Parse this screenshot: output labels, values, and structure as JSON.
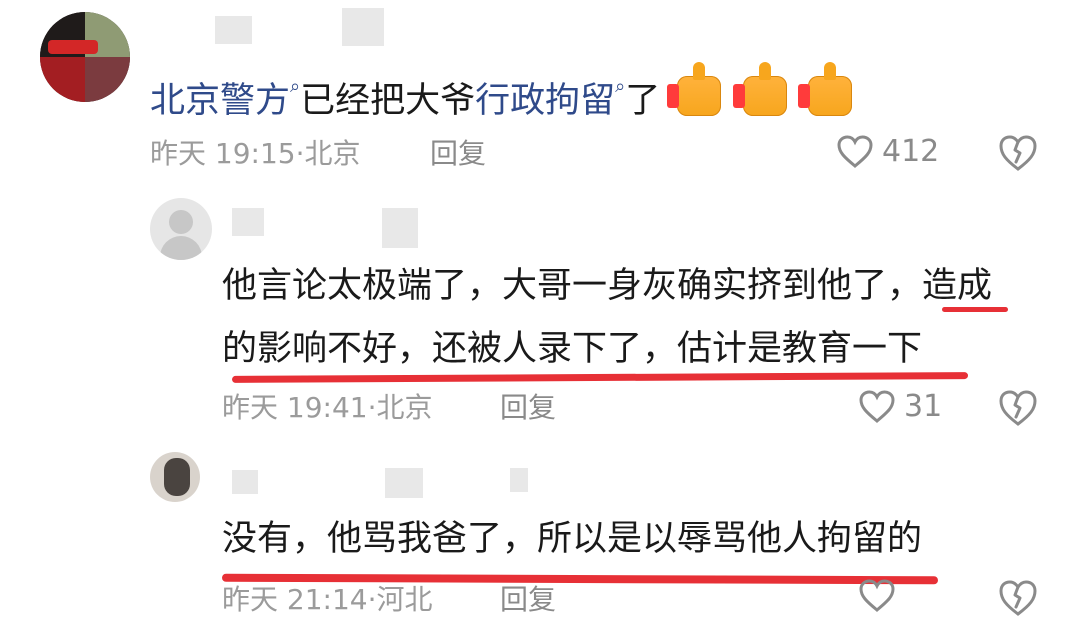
{
  "comments": [
    {
      "text_parts": {
        "topic_1": "北京警方",
        "text_1": "已经把大爷",
        "topic_2": "行政拘留",
        "text_2": "了"
      },
      "time": "昨天 19:15·北京",
      "reply_label": "回复",
      "likes": "412"
    },
    {
      "lines": [
        "他言论太极端了，大哥一身灰确实挤到他了，造成",
        "的影响不好，还被人录下了，估计是教育一下"
      ],
      "time": "昨天 19:41·北京",
      "reply_label": "回复",
      "likes": "31"
    },
    {
      "text": "没有，他骂我爸了，所以是以辱骂他人拘留的",
      "time": "昨天 21:14·河北",
      "reply_label": "回复",
      "likes": ""
    }
  ],
  "icons": {
    "topic": "search-icon",
    "emoji": "thumbs-up-icon",
    "like": "heart-icon",
    "dislike": "broken-heart-icon"
  },
  "colors": {
    "topic": "#2f4a8a",
    "meta": "#9b9b9b",
    "highlight": "#e6252b",
    "thumb": "#f7a61d"
  }
}
